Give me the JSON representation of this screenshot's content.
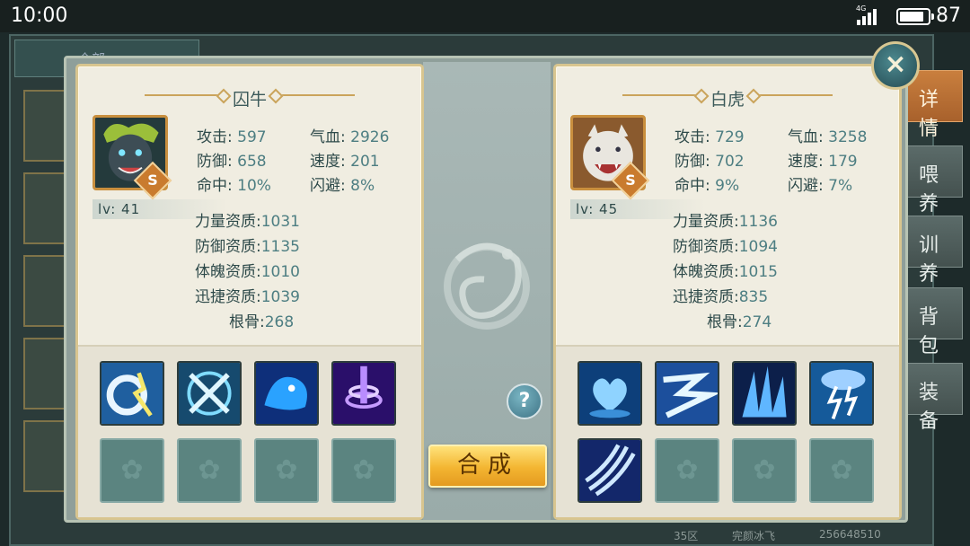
{
  "status_bar": {
    "time": "10:00",
    "network": "4G",
    "battery": "87",
    "battery_fraction": 0.87
  },
  "background": {
    "left_tab": "全部",
    "side_tabs": [
      "详情",
      "喂养",
      "训养",
      "背包",
      "装备"
    ],
    "footer": [
      "35区",
      "完颜冰飞",
      "256648510"
    ]
  },
  "modal": {
    "help_label": "?",
    "compose_label": "合成",
    "close_label": "×",
    "stat_labels": {
      "attack": "攻击:",
      "hp": "气血:",
      "defense": "防御:",
      "speed": "速度:",
      "hit": "命中:",
      "dodge": "闪避:",
      "strength_apt": "力量资质:",
      "defense_apt": "防御资质:",
      "physique_apt": "体魄资质:",
      "agility_apt": "迅捷资质:",
      "bone": "根骨:"
    },
    "left_pet": {
      "name": "囚牛",
      "grade": "S",
      "level": "lv: 41",
      "attack": "597",
      "hp": "2926",
      "defense": "658",
      "speed": "201",
      "hit": "10%",
      "dodge": "8%",
      "strength_apt": "1031",
      "defense_apt": "1135",
      "physique_apt": "1010",
      "agility_apt": "1039",
      "bone": "268",
      "skills": [
        "moon-strike-skill-icon",
        "crossed-blades-skill-icon",
        "blue-beast-skill-icon",
        "purple-vortex-skill-icon"
      ],
      "empty_slots": 4
    },
    "right_pet": {
      "name": "白虎",
      "grade": "S",
      "level": "lv: 45",
      "attack": "729",
      "hp": "3258",
      "defense": "702",
      "speed": "179",
      "hit": "9%",
      "dodge": "7%",
      "strength_apt": "1136",
      "defense_apt": "1094",
      "physique_apt": "1015",
      "agility_apt": "835",
      "bone": "274",
      "skills": [
        "water-heart-skill-icon",
        "lightning-arrow-skill-icon",
        "ice-spikes-skill-icon",
        "thunder-storm-skill-icon",
        "claw-slash-skill-icon"
      ],
      "empty_slots": 3
    }
  },
  "colors": {
    "panel_bg": "#f0ede1",
    "panel_border": "#d8c58f",
    "stat_value": "#4d7e82",
    "compose_gold": "#f3b531",
    "active_tab": "#c97f3e"
  }
}
